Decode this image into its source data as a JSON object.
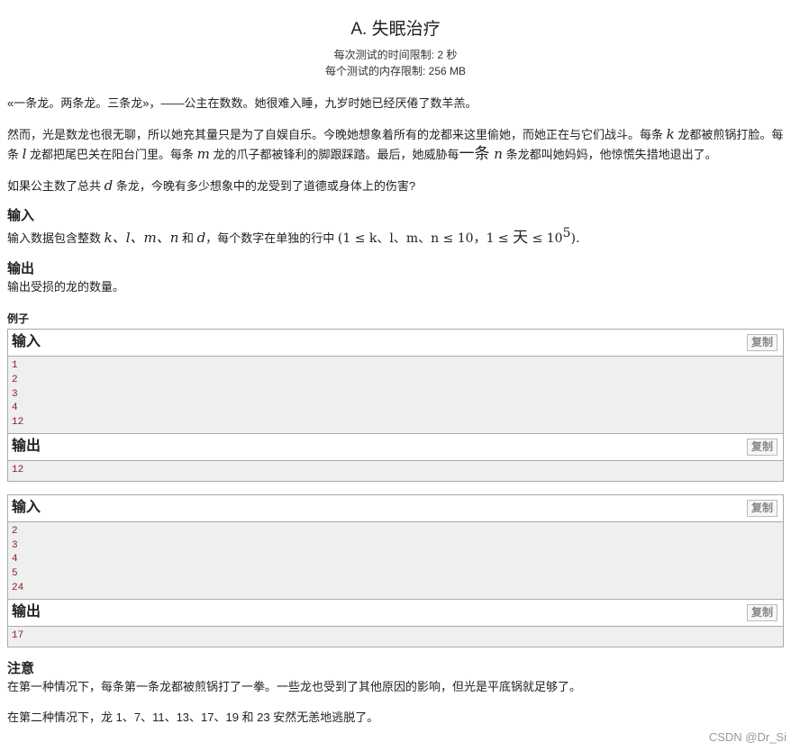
{
  "problem": {
    "title": "A. 失眠治疗",
    "time_limit": "每次测试的时间限制: 2 秒",
    "memory_limit": "每个测试的内存限制: 256 MB"
  },
  "statement": {
    "p1": "«一条龙。两条龙。三条龙»，——公主在数数。她很难入睡，九岁时她已经厌倦了数羊羔。",
    "p2_a": "然而，光是数龙也很无聊，所以她充其量只是为了自娱自乐。今晚她想象着所有的龙都来这里偷她，而她正在与它们战斗。每条 ",
    "p2_k": "k",
    "p2_b": " 龙都被煎锅打脸。每条 ",
    "p2_l": "l",
    "p2_c": " 龙都把尾巴关在阳台门里。每条 ",
    "p2_m": "m",
    "p2_d": " 龙的爪子都被锋利的脚跟踩踏。最后，她威胁每",
    "p2_big": "一条",
    "p2_n": " n",
    "p2_e": " 条龙都叫她妈妈，他惊慌失措地退出了。",
    "p3_a": "如果公主数了总共 ",
    "p3_d": "d",
    "p3_b": " 条龙，今晚有多少想象中的龙受到了道德或身体上的伤害?"
  },
  "input_section": {
    "heading": "输入",
    "text_a": "输入数据包含整数 ",
    "vars": "k、l、m、n",
    "text_and": " 和 ",
    "var_d": "d",
    "text_b": "，每个数字在单独的行中 ",
    "constraint_a": "(1 ≤ k、l、m、n ≤ 10，1 ≤ ",
    "constraint_tian": "天",
    "constraint_b": " ≤ 10",
    "constraint_exp": "5",
    "constraint_c": ")."
  },
  "output_section": {
    "heading": "输出",
    "text": "输出受损的龙的数量。"
  },
  "examples": {
    "heading": "例子",
    "copy_label": "复制",
    "input_label": "输入",
    "output_label": "输出",
    "list": [
      {
        "input_lines": [
          "1",
          "2",
          "3",
          "4",
          "12"
        ],
        "output_lines": [
          "12"
        ]
      },
      {
        "input_lines": [
          "2",
          "3",
          "4",
          "5",
          "24"
        ],
        "output_lines": [
          "17"
        ]
      }
    ]
  },
  "note": {
    "heading": "注意",
    "p1": "在第一种情况下，每条第一条龙都被煎锅打了一拳。一些龙也受到了其他原因的影响，但光是平底锅就足够了。",
    "p2": "在第二种情况下，龙 1、7、11、13、17、19 和 23 安然无恙地逃脱了。"
  },
  "watermark": "CSDN @Dr_Si"
}
